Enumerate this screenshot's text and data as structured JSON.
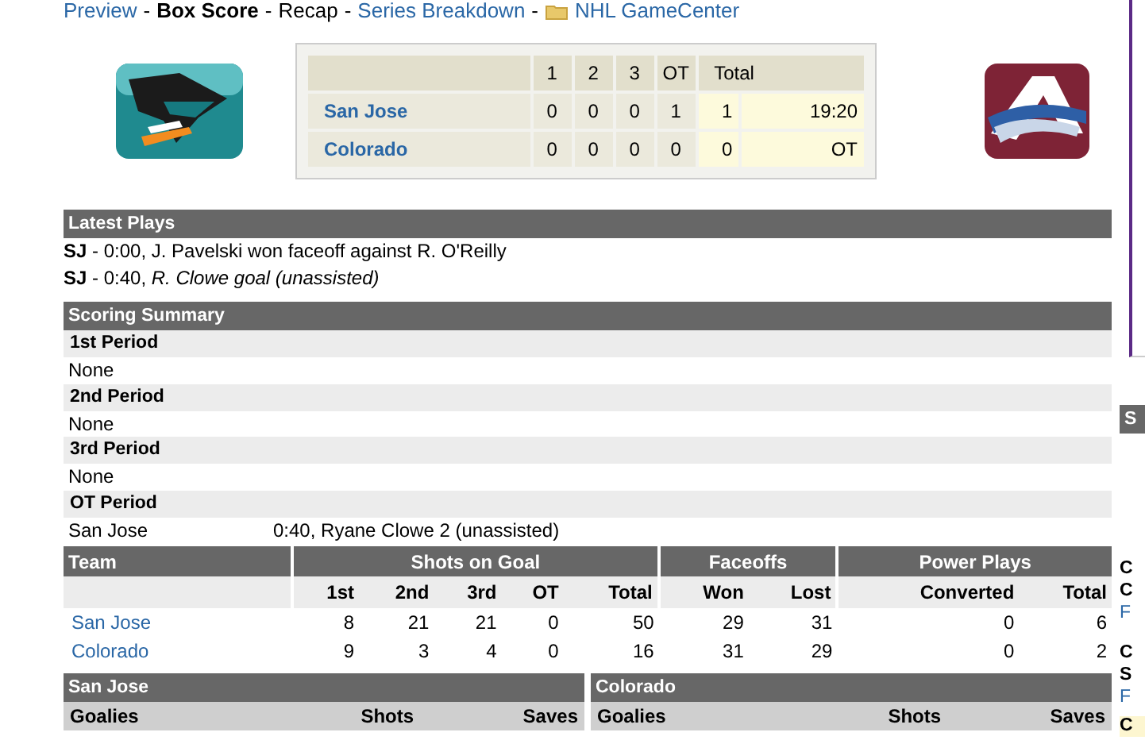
{
  "nav": [
    {
      "kind": "link",
      "label": "Preview"
    },
    {
      "kind": "separator",
      "label": "-"
    },
    {
      "kind": "current",
      "label": "Box Score"
    },
    {
      "kind": "separator",
      "label": "-"
    },
    {
      "kind": "plain",
      "label": "Recap"
    },
    {
      "kind": "separator",
      "label": "-"
    },
    {
      "kind": "link",
      "label": "Series Breakdown"
    },
    {
      "kind": "separator",
      "label": "-"
    },
    {
      "kind": "icon-link",
      "label": "NHL GameCenter"
    }
  ],
  "scoreboard": {
    "columns": [
      "1",
      "2",
      "3",
      "OT",
      "Total"
    ],
    "rows": [
      {
        "team": "San Jose",
        "periods": [
          "0",
          "0",
          "0",
          "1"
        ],
        "total": "1",
        "status": "19:20"
      },
      {
        "team": "Colorado",
        "periods": [
          "0",
          "0",
          "0",
          "0"
        ],
        "total": "0",
        "status": "OT"
      }
    ]
  },
  "latest_plays": {
    "title": "Latest Plays",
    "items": [
      "**SJ** - 0:00, J. Pavelski won faceoff against R. O'Reilly",
      "**SJ** - 0:40, *R. Clowe goal (unassisted)*"
    ]
  },
  "scoring_summary": {
    "title": "Scoring Summary",
    "periods": [
      {
        "name": "1st Period",
        "entries": [
          {
            "team": "None"
          }
        ]
      },
      {
        "name": "2nd Period",
        "entries": [
          {
            "team": "None"
          }
        ]
      },
      {
        "name": "3rd Period",
        "entries": [
          {
            "team": "None"
          }
        ]
      },
      {
        "name": "OT Period",
        "entries": [
          {
            "team": "San Jose",
            "detail": "0:40, Ryane Clowe 2 (unassisted)"
          }
        ]
      }
    ]
  },
  "team_stats": {
    "groups": [
      "Team",
      "Shots on Goal",
      "Faceoffs",
      "Power Plays"
    ],
    "columns": [
      "1st",
      "2nd",
      "3rd",
      "OT",
      "Total",
      "Won",
      "Lost",
      "Converted",
      "Total"
    ],
    "rows": [
      {
        "team": "San Jose",
        "values": [
          "8",
          "21",
          "21",
          "0",
          "50",
          "29",
          "31",
          "0",
          "6"
        ]
      },
      {
        "team": "Colorado",
        "values": [
          "9",
          "3",
          "4",
          "0",
          "16",
          "31",
          "29",
          "0",
          "2"
        ]
      }
    ]
  },
  "goalies": [
    {
      "team": "San Jose",
      "columns": [
        "Goalies",
        "Shots",
        "Saves"
      ]
    },
    {
      "team": "Colorado",
      "columns": [
        "Goalies",
        "Shots",
        "Saves"
      ]
    }
  ],
  "sidebar_fragments": [
    {
      "kind": "header",
      "text": "S"
    },
    {
      "kind": "bold",
      "text": "C"
    },
    {
      "kind": "bold",
      "text": "C"
    },
    {
      "kind": "link",
      "text": "F"
    },
    {
      "kind": "bold",
      "text": "C"
    },
    {
      "kind": "bold",
      "text": "S"
    },
    {
      "kind": "link",
      "text": "F"
    },
    {
      "kind": "note",
      "text": "C"
    }
  ]
}
